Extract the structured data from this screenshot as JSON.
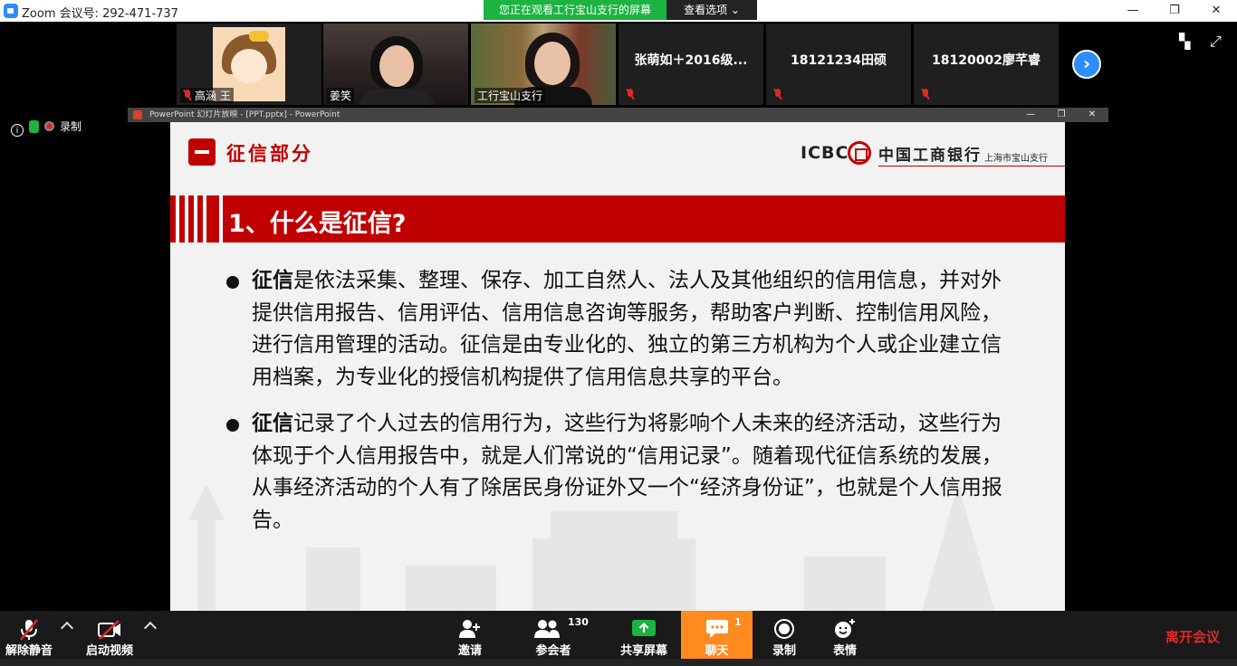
{
  "window": {
    "title": "Zoom 会议号: 292-471-737",
    "minimize": "—",
    "restore": "❐",
    "close": "✕"
  },
  "share": {
    "banner": "您正在观看工行宝山支行的屏幕",
    "view_options": "查看选项 ⌄"
  },
  "participants": [
    {
      "label": "高涵 王",
      "muted": true,
      "kind": "cartoon"
    },
    {
      "label": "姜笑",
      "muted": false,
      "kind": "video"
    },
    {
      "label": "工行宝山支行",
      "muted": false,
      "kind": "video",
      "active": true
    },
    {
      "label": "张萌如＋2016级...",
      "muted": true,
      "kind": "name"
    },
    {
      "label": "18121234田硕",
      "muted": true,
      "kind": "name"
    },
    {
      "label": "18120002廖芊睿",
      "muted": true,
      "kind": "name"
    }
  ],
  "strip_icons": {
    "layout": "▚",
    "fullscreen": "⤢"
  },
  "status": {
    "info": "i",
    "recording_label": "录制"
  },
  "ppt": {
    "title": "PowerPoint 幻灯片放映 - [PPT.pptx] - PowerPoint",
    "min": "—",
    "max": "❐",
    "close": "✕"
  },
  "slide": {
    "section_title": "征信部分",
    "brand_en": "ICBC",
    "brand_cn": "中国工商银行",
    "branch": "上海市宝山支行",
    "heading": "1、什么是征信?",
    "bullets": [
      {
        "term": "征信",
        "text": "是依法采集、整理、保存、加工自然人、法人及其他组织的信用信息，并对外提供信用报告、信用评估、信用信息咨询等服务，帮助客户判断、控制信用风险，进行信用管理的活动。征信是由专业化的、独立的第三方机构为个人或企业建立信用档案，为专业化的授信机构提供了信用信息共享的平台。"
      },
      {
        "term": "征信",
        "text": "记录了个人过去的信用行为，这些行为将影响个人未来的经济活动，这些行为体现于个人信用报告中，就是人们常说的“信用记录”。随着现代征信系统的发展，从事经济活动的个人有了除居民身份证外又一个“经济身份证”，也就是个人信用报告。"
      }
    ]
  },
  "toolbar": {
    "unmute": "解除静音",
    "start_video": "启动视频",
    "invite": "邀请",
    "participants": "参会者",
    "participant_count": "130",
    "share_screen": "共享屏幕",
    "chat": "聊天",
    "chat_unread": "1",
    "record": "录制",
    "reactions": "表情",
    "leave": "离开会议"
  },
  "colors": {
    "zoom_blue": "#2d8cff",
    "share_green": "#1db341",
    "icbc_red": "#c00000",
    "chat_orange": "#ff8a1f",
    "leave_red": "#e02828"
  }
}
